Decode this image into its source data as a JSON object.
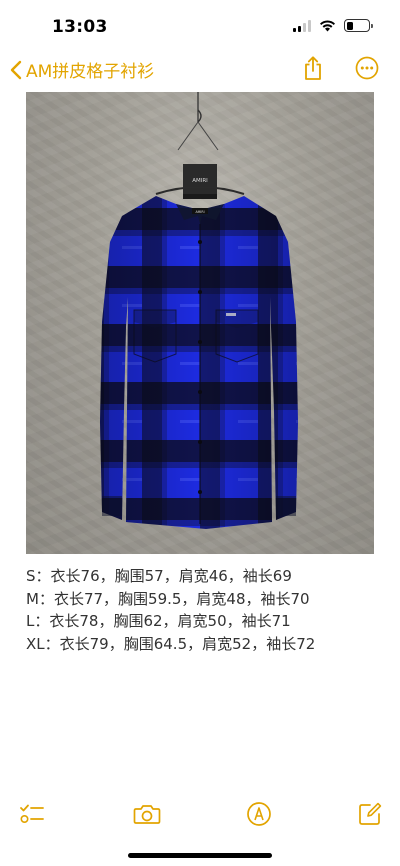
{
  "status_bar": {
    "time": "13:03"
  },
  "nav": {
    "back_label": "AM拼皮格子衬衫"
  },
  "photo": {
    "hanger_tag": "AMIRI",
    "collar_label": "AMIRI"
  },
  "note": {
    "lines": [
      "S：衣长76，胸围57，肩宽46，袖长69",
      "M：衣长77，胸围59.5，肩宽48，袖长70",
      "L：衣长78，胸围62，肩宽50，袖长71",
      "XL：衣长79，胸围64.5，肩宽52，袖长72"
    ]
  },
  "colors": {
    "accent": "#e2a400",
    "shirt_blue": "#1f2fd6",
    "shirt_black": "#0d0d18"
  },
  "icons": {
    "back": "chevron-left-icon",
    "share": "share-icon",
    "more": "more-icon",
    "checklist": "checklist-icon",
    "camera": "camera-icon",
    "markup": "markup-icon",
    "compose": "compose-icon"
  }
}
